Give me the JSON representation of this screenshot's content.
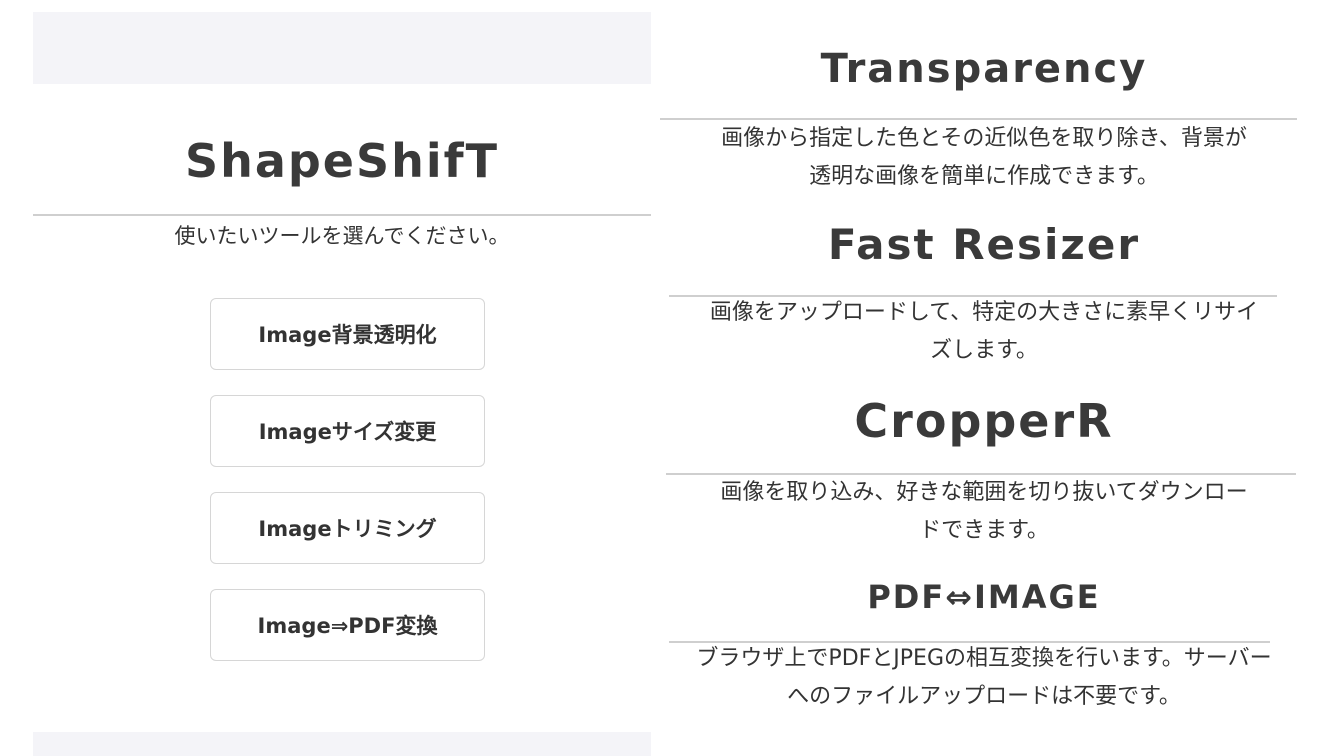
{
  "left": {
    "brand_title": "ShapeShifT",
    "intro": "使いたいツールを選んでください。",
    "buttons": [
      {
        "label": "Image背景透明化"
      },
      {
        "label": "Imageサイズ変更"
      },
      {
        "label": "Imageトリミング"
      },
      {
        "label": "Image⇒PDF変換"
      }
    ]
  },
  "features": [
    {
      "title": "Transparency",
      "description_line1": "画像から指定した色とその近似色を取り除き、背景が",
      "description_line2": "透明な画像を簡単に作成できます。"
    },
    {
      "title": "Fast Resizer",
      "description_line1": "画像をアップロードして、特定の大きさに素早くリサイ",
      "description_line2": "ズします。"
    },
    {
      "title": "CropperR",
      "description_line1": "画像を取り込み、好きな範囲を切り抜いてダウンロー",
      "description_line2": "ドできます。"
    },
    {
      "title": "PDF⇔IMAGE",
      "description_line1": "ブラウザ上でPDFとJPEGの相互変換を行います。サーバー",
      "description_line2": "へのファイルアップロードは不要です。"
    }
  ],
  "colors": {
    "band": "#f4f4f8",
    "text": "#333333",
    "rule": "#cfcfcf",
    "button_border": "#d6d6d6"
  }
}
